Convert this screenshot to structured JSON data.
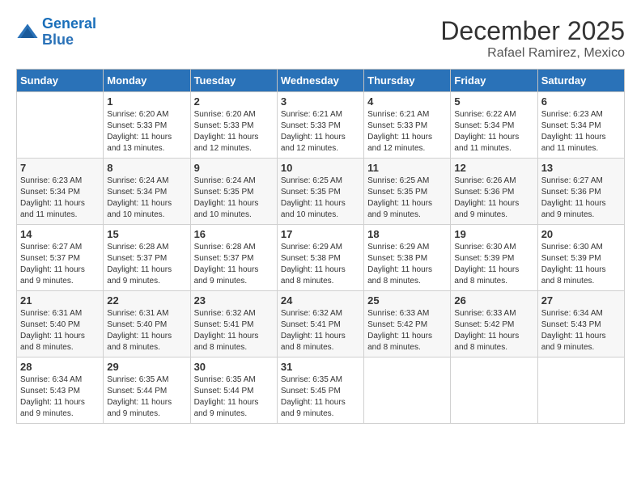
{
  "header": {
    "logo_line1": "General",
    "logo_line2": "Blue",
    "month_title": "December 2025",
    "subtitle": "Rafael Ramirez, Mexico"
  },
  "weekdays": [
    "Sunday",
    "Monday",
    "Tuesday",
    "Wednesday",
    "Thursday",
    "Friday",
    "Saturday"
  ],
  "weeks": [
    [
      {
        "day": "",
        "sunrise": "",
        "sunset": "",
        "daylight": ""
      },
      {
        "day": "1",
        "sunrise": "6:20 AM",
        "sunset": "5:33 PM",
        "daylight": "11 hours and 13 minutes."
      },
      {
        "day": "2",
        "sunrise": "6:20 AM",
        "sunset": "5:33 PM",
        "daylight": "11 hours and 12 minutes."
      },
      {
        "day": "3",
        "sunrise": "6:21 AM",
        "sunset": "5:33 PM",
        "daylight": "11 hours and 12 minutes."
      },
      {
        "day": "4",
        "sunrise": "6:21 AM",
        "sunset": "5:33 PM",
        "daylight": "11 hours and 12 minutes."
      },
      {
        "day": "5",
        "sunrise": "6:22 AM",
        "sunset": "5:34 PM",
        "daylight": "11 hours and 11 minutes."
      },
      {
        "day": "6",
        "sunrise": "6:23 AM",
        "sunset": "5:34 PM",
        "daylight": "11 hours and 11 minutes."
      }
    ],
    [
      {
        "day": "7",
        "sunrise": "6:23 AM",
        "sunset": "5:34 PM",
        "daylight": "11 hours and 11 minutes."
      },
      {
        "day": "8",
        "sunrise": "6:24 AM",
        "sunset": "5:34 PM",
        "daylight": "11 hours and 10 minutes."
      },
      {
        "day": "9",
        "sunrise": "6:24 AM",
        "sunset": "5:35 PM",
        "daylight": "11 hours and 10 minutes."
      },
      {
        "day": "10",
        "sunrise": "6:25 AM",
        "sunset": "5:35 PM",
        "daylight": "11 hours and 10 minutes."
      },
      {
        "day": "11",
        "sunrise": "6:25 AM",
        "sunset": "5:35 PM",
        "daylight": "11 hours and 9 minutes."
      },
      {
        "day": "12",
        "sunrise": "6:26 AM",
        "sunset": "5:36 PM",
        "daylight": "11 hours and 9 minutes."
      },
      {
        "day": "13",
        "sunrise": "6:27 AM",
        "sunset": "5:36 PM",
        "daylight": "11 hours and 9 minutes."
      }
    ],
    [
      {
        "day": "14",
        "sunrise": "6:27 AM",
        "sunset": "5:37 PM",
        "daylight": "11 hours and 9 minutes."
      },
      {
        "day": "15",
        "sunrise": "6:28 AM",
        "sunset": "5:37 PM",
        "daylight": "11 hours and 9 minutes."
      },
      {
        "day": "16",
        "sunrise": "6:28 AM",
        "sunset": "5:37 PM",
        "daylight": "11 hours and 9 minutes."
      },
      {
        "day": "17",
        "sunrise": "6:29 AM",
        "sunset": "5:38 PM",
        "daylight": "11 hours and 8 minutes."
      },
      {
        "day": "18",
        "sunrise": "6:29 AM",
        "sunset": "5:38 PM",
        "daylight": "11 hours and 8 minutes."
      },
      {
        "day": "19",
        "sunrise": "6:30 AM",
        "sunset": "5:39 PM",
        "daylight": "11 hours and 8 minutes."
      },
      {
        "day": "20",
        "sunrise": "6:30 AM",
        "sunset": "5:39 PM",
        "daylight": "11 hours and 8 minutes."
      }
    ],
    [
      {
        "day": "21",
        "sunrise": "6:31 AM",
        "sunset": "5:40 PM",
        "daylight": "11 hours and 8 minutes."
      },
      {
        "day": "22",
        "sunrise": "6:31 AM",
        "sunset": "5:40 PM",
        "daylight": "11 hours and 8 minutes."
      },
      {
        "day": "23",
        "sunrise": "6:32 AM",
        "sunset": "5:41 PM",
        "daylight": "11 hours and 8 minutes."
      },
      {
        "day": "24",
        "sunrise": "6:32 AM",
        "sunset": "5:41 PM",
        "daylight": "11 hours and 8 minutes."
      },
      {
        "day": "25",
        "sunrise": "6:33 AM",
        "sunset": "5:42 PM",
        "daylight": "11 hours and 8 minutes."
      },
      {
        "day": "26",
        "sunrise": "6:33 AM",
        "sunset": "5:42 PM",
        "daylight": "11 hours and 8 minutes."
      },
      {
        "day": "27",
        "sunrise": "6:34 AM",
        "sunset": "5:43 PM",
        "daylight": "11 hours and 9 minutes."
      }
    ],
    [
      {
        "day": "28",
        "sunrise": "6:34 AM",
        "sunset": "5:43 PM",
        "daylight": "11 hours and 9 minutes."
      },
      {
        "day": "29",
        "sunrise": "6:35 AM",
        "sunset": "5:44 PM",
        "daylight": "11 hours and 9 minutes."
      },
      {
        "day": "30",
        "sunrise": "6:35 AM",
        "sunset": "5:44 PM",
        "daylight": "11 hours and 9 minutes."
      },
      {
        "day": "31",
        "sunrise": "6:35 AM",
        "sunset": "5:45 PM",
        "daylight": "11 hours and 9 minutes."
      },
      {
        "day": "",
        "sunrise": "",
        "sunset": "",
        "daylight": ""
      },
      {
        "day": "",
        "sunrise": "",
        "sunset": "",
        "daylight": ""
      },
      {
        "day": "",
        "sunrise": "",
        "sunset": "",
        "daylight": ""
      }
    ]
  ]
}
